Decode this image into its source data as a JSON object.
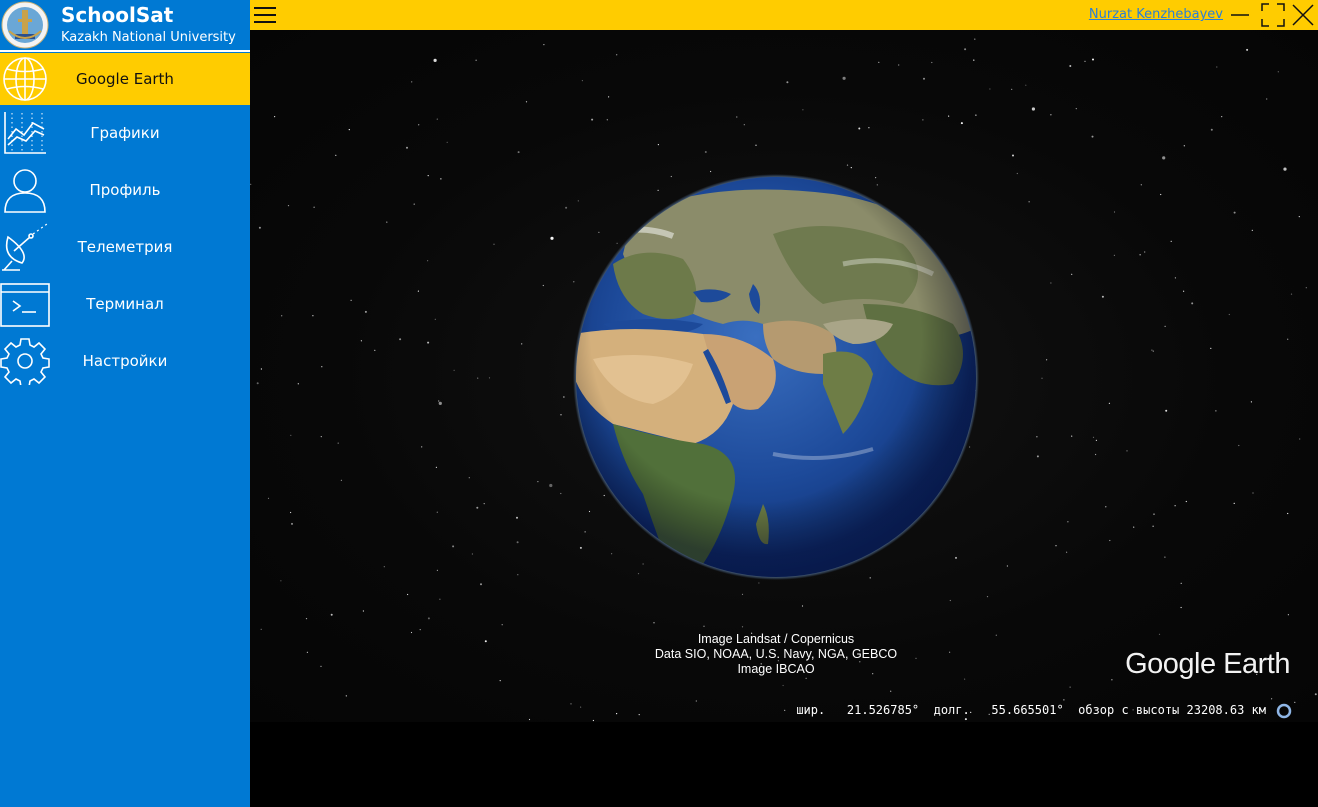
{
  "app": {
    "name": "SchoolSat",
    "subtitle": "Kazakh National University"
  },
  "sidebar": {
    "items": [
      {
        "label": "Google Earth",
        "icon": "globe-icon",
        "active": true
      },
      {
        "label": "Графики",
        "icon": "chart-icon",
        "active": false
      },
      {
        "label": "Профиль",
        "icon": "user-icon",
        "active": false
      },
      {
        "label": "Телеметрия",
        "icon": "satellite-dish-icon",
        "active": false
      },
      {
        "label": "Терминал",
        "icon": "terminal-icon",
        "active": false
      },
      {
        "label": "Настройки",
        "icon": "gear-icon",
        "active": false
      }
    ]
  },
  "topbar": {
    "user_name": "Nurzat Kenzhebayev",
    "menu_icon": "hamburger-icon",
    "window_controls": [
      "minimize-icon",
      "maximize-icon",
      "close-icon"
    ]
  },
  "earth": {
    "attribution": [
      "Image Landsat / Copernicus",
      "Data SIO, NOAA, U.S. Navy, NGA, GEBCO",
      "Image IBCAO"
    ],
    "logo_text_google": "Google",
    "logo_text_earth": "Earth",
    "status": {
      "lat_label": "шир.",
      "lat_value": "21.526785°",
      "lon_label": "долг.",
      "lon_value": "55.665501°",
      "alt_label": "обзор с высоты",
      "alt_value": "23208.63 км"
    }
  },
  "colors": {
    "sidebar": "#0079d3",
    "accent": "#ffcc00",
    "link": "#2a7fd6",
    "space": "#0a0a0a"
  }
}
